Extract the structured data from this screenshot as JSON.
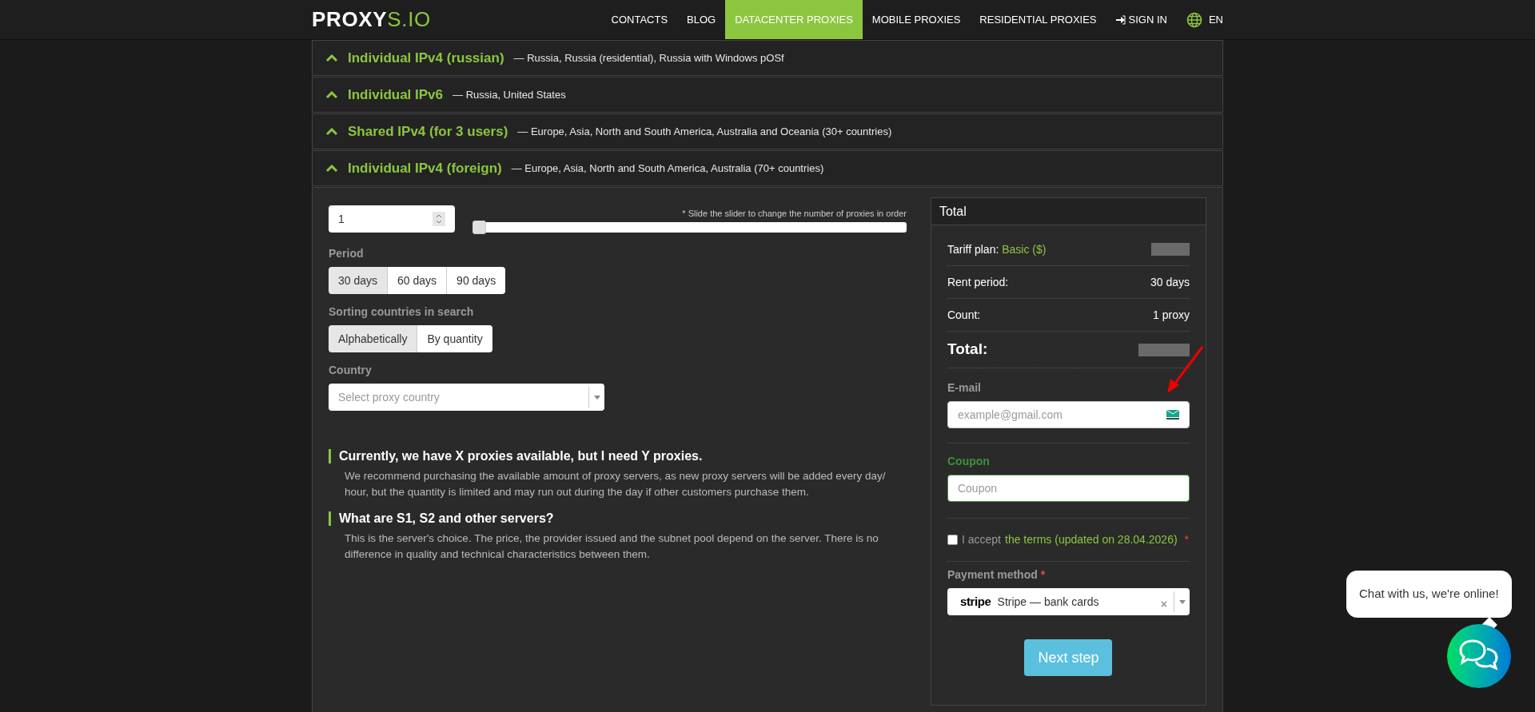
{
  "nav": {
    "logo_main": "PROXY",
    "logo_accent": "S.IO",
    "items": [
      {
        "label": "CONTACTS",
        "selected": false,
        "kind": "link"
      },
      {
        "label": "BLOG",
        "selected": false,
        "kind": "link"
      },
      {
        "label": "DATACENTER PROXIES",
        "selected": true,
        "kind": "link"
      },
      {
        "label": "MOBILE PROXIES",
        "selected": false,
        "kind": "link"
      },
      {
        "label": "RESIDENTIAL PROXIES",
        "selected": false,
        "kind": "link"
      },
      {
        "label": "SIGN IN",
        "selected": false,
        "kind": "signin"
      }
    ],
    "language": "EN"
  },
  "categories": [
    {
      "title": "Individual IPv4 (russian)",
      "description": "— Russia, Russia (residential), Russia with Windows pOSf"
    },
    {
      "title": "Individual IPv6",
      "description": "— Russia, United States"
    },
    {
      "title": "Shared IPv4 (for 3 users)",
      "description": "— Europe, Asia, North and South America, Australia and Oceania (30+ countries)"
    },
    {
      "title": "Individual IPv4 (foreign)",
      "description": "— Europe, Asia, North and South America, Australia (70+ countries)"
    }
  ],
  "order": {
    "quantity": "1",
    "slider_hint": "* Slide the slider to change the number of proxies in order",
    "slider": {
      "level": 0
    },
    "period_label": "Period",
    "periods": [
      {
        "label": "30 days",
        "selected": true
      },
      {
        "label": "60 days",
        "selected": false
      },
      {
        "label": "90 days",
        "selected": false
      }
    ],
    "sorting_label": "Sorting countries in search",
    "sortings": [
      {
        "label": "Alphabetically",
        "selected": true
      },
      {
        "label": "By quantity",
        "selected": false
      }
    ],
    "country_label": "Country",
    "country_placeholder": "Select proxy country",
    "faq": [
      {
        "question": "Currently, we have X proxies available, but I need Y proxies.",
        "answer": "We recommend purchasing the available amount of proxy servers, as new proxy servers will be added every day/ hour, but the quantity is limited and may run out during the day if other customers purchase them."
      },
      {
        "question": "What are S1, S2 and other servers?",
        "answer": "This is the server's choice. The price, the provider issued and the subnet pool depend on the server. There is no difference in quality and technical characteristics between them."
      }
    ]
  },
  "total": {
    "title": "Total",
    "rows": [
      {
        "kind": "plan",
        "label": "Tariff plan:",
        "accent": "Basic ($)"
      },
      {
        "kind": "line",
        "label": "Rent period:",
        "value": "30 days"
      },
      {
        "kind": "line",
        "label": "Count:",
        "value": "1 proxy"
      },
      {
        "kind": "grand",
        "label": "Total:"
      }
    ],
    "email_label": "E-mail",
    "email_placeholder": "example@gmail.com",
    "coupon_label": "Coupon",
    "coupon_placeholder": "Coupon",
    "terms": {
      "checked": false,
      "prefix": "I accept",
      "link": "the terms (updated on 28.04.2026)",
      "required": "*"
    },
    "payment_label": "Payment method",
    "payment_required": "*",
    "payment_brand": "stripe",
    "payment_value": "Stripe — bank cards",
    "payment_clear": "×",
    "next_button": "Next step"
  },
  "chat": {
    "bubble": "Chat with us, we're online!"
  }
}
